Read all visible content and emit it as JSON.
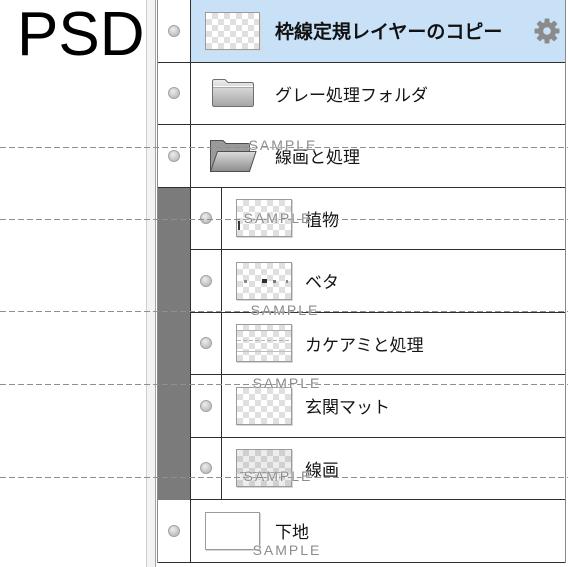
{
  "format_label": "PSD",
  "colors": {
    "selected_row_bg": "#c8e1f7",
    "folder_indent_bar": "#7b7b7b",
    "row_divider": "#2e2e2e",
    "watermark": "#8c8c8c"
  },
  "layers_panel": {
    "visibility_icon": "visibility-dot-icon"
  },
  "layers": [
    {
      "name": "枠線定規レイヤーのコピー",
      "selected": true,
      "icon": "transparent-thumbnail-icon",
      "settings_icon": "gear-icon"
    },
    {
      "name": "グレー処理フォルダ",
      "expanded": false,
      "icon": "folder-closed-icon"
    },
    {
      "name": "線画と処理",
      "expanded": true,
      "icon": "folder-open-icon",
      "children": [
        {
          "name": "植物",
          "icon": "transparent-thumbnail-icon"
        },
        {
          "name": "ベタ",
          "icon": "transparent-thumbnail-icon"
        },
        {
          "name": "カケアミと処理",
          "icon": "transparent-thumbnail-icon"
        },
        {
          "name": "玄関マット",
          "icon": "transparent-thumbnail-icon"
        },
        {
          "name": "線画",
          "icon": "transparent-thumbnail-icon"
        }
      ]
    },
    {
      "name": "下地",
      "icon": "white-thumbnail-icon"
    }
  ],
  "watermark": {
    "text": "SAMPLE"
  }
}
